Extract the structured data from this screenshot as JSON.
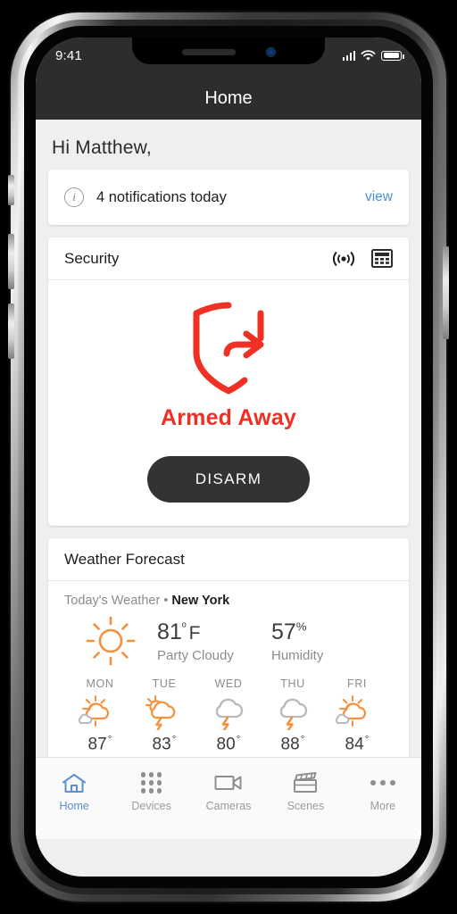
{
  "status_bar": {
    "time": "9:41",
    "signal_icon": "cellular-bars-icon",
    "wifi_icon": "wifi-icon",
    "battery_icon": "battery-icon"
  },
  "nav": {
    "title": "Home"
  },
  "greeting": "Hi Matthew,",
  "notification": {
    "icon": "info-icon",
    "text": "4 notifications today",
    "action_label": "view"
  },
  "security": {
    "title": "Security",
    "signal_icon": "broadcast-signal-icon",
    "keypad_icon": "keypad-panel-icon",
    "shield_icon": "shield-arrow-away-icon",
    "status": "Armed Away",
    "button_label": "DISARM"
  },
  "weather": {
    "title": "Weather Forecast",
    "today_label": "Today's Weather",
    "separator": "•",
    "location": "New York",
    "current_icon": "sun-icon",
    "temperature": "81",
    "temperature_degree": "º",
    "temperature_unit": "F",
    "condition": "Party Cloudy",
    "humidity": "57",
    "humidity_unit": "%",
    "humidity_label": "Humidity",
    "forecast": [
      {
        "day": "MON",
        "icon": "sun-cloud-icon",
        "temp": "87",
        "degree": "°"
      },
      {
        "day": "TUE",
        "icon": "sun-cloud-storm-icon",
        "temp": "83",
        "degree": "°"
      },
      {
        "day": "WED",
        "icon": "cloud-storm-icon",
        "temp": "80",
        "degree": "°"
      },
      {
        "day": "THU",
        "icon": "cloud-storm-icon",
        "temp": "88",
        "degree": "°"
      },
      {
        "day": "FRI",
        "icon": "sun-cloud-icon",
        "temp": "84",
        "degree": "°"
      }
    ]
  },
  "tabs": [
    {
      "label": "Home",
      "icon": "home-icon",
      "active": true
    },
    {
      "label": "Devices",
      "icon": "grid-dots-icon",
      "active": false
    },
    {
      "label": "Cameras",
      "icon": "video-camera-icon",
      "active": false
    },
    {
      "label": "Scenes",
      "icon": "clapperboard-icon",
      "active": false
    },
    {
      "label": "More",
      "icon": "ellipsis-icon",
      "active": false
    }
  ],
  "colors": {
    "alert_red": "#EE3124",
    "accent_blue": "#4A90D9",
    "tab_active_blue": "#5B8FD4",
    "weather_orange": "#F5913E",
    "navbar_dark": "#2D2D2D",
    "button_dark": "#333333"
  }
}
